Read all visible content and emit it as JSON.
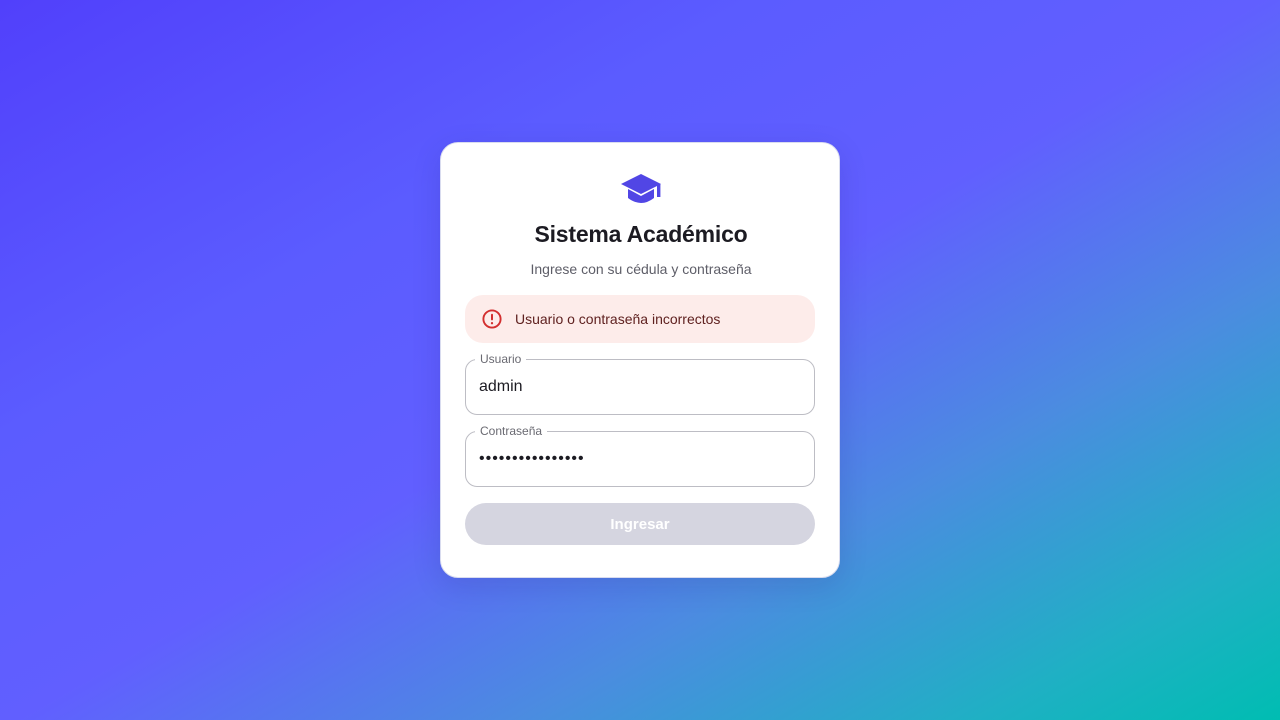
{
  "app": {
    "title": "Sistema Académico",
    "subtitle": "Ingrese con su cédula y contraseña",
    "logo_icon": "graduation-cap-icon"
  },
  "alert": {
    "icon": "error-outline-icon",
    "message": "Usuario o contraseña incorrectos"
  },
  "form": {
    "username": {
      "label": "Usuario",
      "value": "admin"
    },
    "password": {
      "label": "Contraseña",
      "value": "••••••••••••••••"
    },
    "submit_label": "Ingresar",
    "submit_disabled": true
  },
  "colors": {
    "accent": "#5146e5",
    "error": "#d32f2f",
    "alert_bg": "#fdecea",
    "disabled_button": "#d5d5e0"
  }
}
